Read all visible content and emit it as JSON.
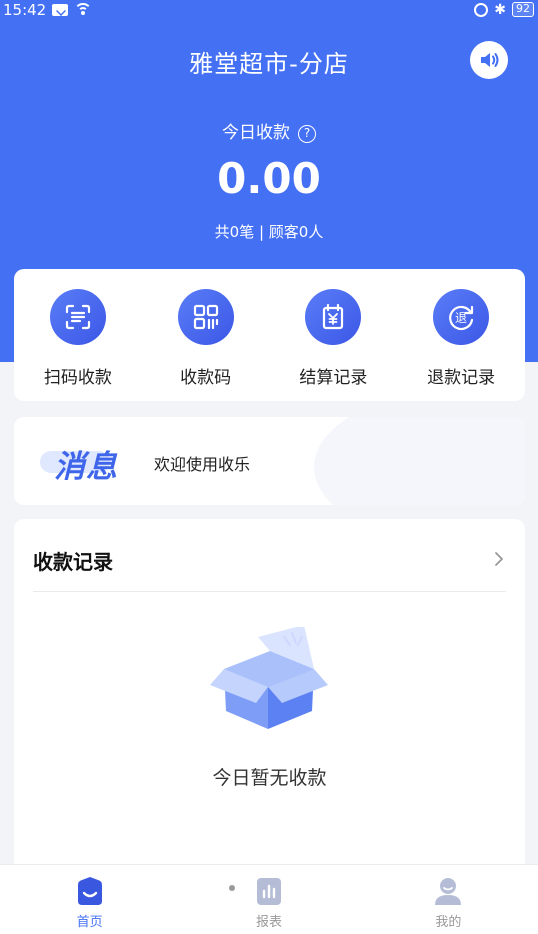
{
  "status_bar": {
    "time": "15:42",
    "battery": "92",
    "icons": [
      "mail-icon",
      "wifi-icon",
      "lock-icon",
      "bluetooth-icon",
      "battery-icon"
    ]
  },
  "header": {
    "store_name": "雅堂超市-分店",
    "speaker_icon": "speaker-icon"
  },
  "summary": {
    "today_label": "今日收款",
    "help_icon": "?",
    "amount": "0.00",
    "stats": "共0笔 | 顾客0人"
  },
  "actions": [
    {
      "label": "扫码收款",
      "icon": "scan-icon"
    },
    {
      "label": "收款码",
      "icon": "qrcode-icon"
    },
    {
      "label": "结算记录",
      "icon": "settlement-icon"
    },
    {
      "label": "退款记录",
      "icon": "refund-icon"
    }
  ],
  "message": {
    "badge": "消息",
    "text": "欢迎使用收乐"
  },
  "records": {
    "title": "收款记录",
    "empty_text": "今日暂无收款"
  },
  "tabbar": {
    "items": [
      {
        "label": "首页",
        "icon": "home-icon",
        "active": true
      },
      {
        "label": "报表",
        "icon": "report-icon",
        "active": false
      },
      {
        "label": "我的",
        "icon": "profile-icon",
        "active": false
      }
    ]
  },
  "colors": {
    "primary": "#4470f4",
    "background": "#f3f4f7"
  }
}
